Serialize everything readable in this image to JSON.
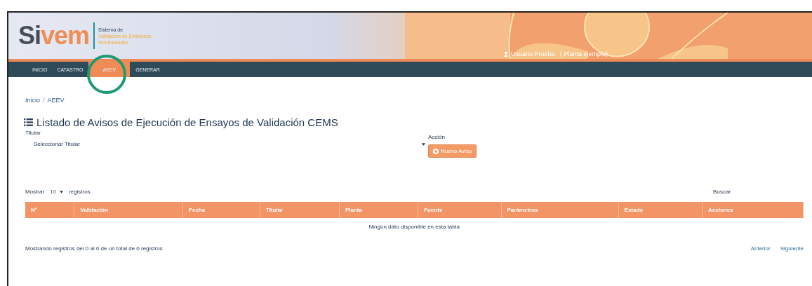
{
  "header": {
    "logo_dark": "Si",
    "logo_accent": "vem",
    "tagline": [
      "Sistema de",
      "Validación de Emisiones",
      "Monitoreadas"
    ],
    "user": "Usuario Prueba",
    "plant": "( Planta ejemplo)"
  },
  "nav": [
    {
      "label": "INICIO",
      "selected": false
    },
    {
      "label": "CATASTRO",
      "selected": false
    },
    {
      "label": "AEEV",
      "selected": true
    },
    {
      "label": "GENERAR",
      "selected": false
    }
  ],
  "breadcrumb": {
    "items": [
      "Inicio",
      "AEEV"
    ],
    "separator": "/"
  },
  "title": "Listado de Avisos de Ejecución de Ensayos de Validación CEMS",
  "filter": {
    "label": "Titular",
    "placeholder": "Seleccionar Titular"
  },
  "action": {
    "label": "Acción",
    "button": "Nuevo Aviso"
  },
  "length": {
    "before": "Mostrar",
    "value": "10",
    "after": "registros"
  },
  "search_label": "Buscar",
  "table": {
    "columns": [
      "N°",
      "Validación",
      "Fecha",
      "Titular",
      "Planta",
      "Fuente",
      "Parámetros",
      "Estado",
      "Acciones"
    ],
    "empty": "Ningún dato disponible en esta tabla"
  },
  "info": "Mostrando registros del 0 al 0 de un total de 0 registros",
  "pager": [
    "Anterior",
    "Siguiente"
  ]
}
